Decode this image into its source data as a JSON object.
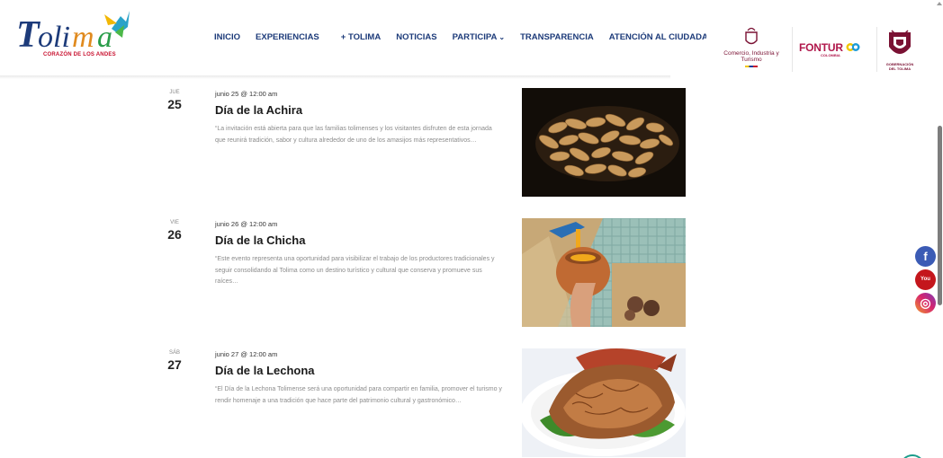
{
  "header": {
    "logo_text": "Tolima",
    "logo_tagline": "CORAZÓN DE LOS ANDES",
    "nav": [
      {
        "label": "INICIO"
      },
      {
        "label": "EXPERIENCIAS"
      },
      {
        "label": "+ TOLIMA"
      },
      {
        "label": "NOTICIAS"
      },
      {
        "label": "PARTICIPA"
      },
      {
        "label": "TRANSPARENCIA"
      },
      {
        "label": "ATENCIÓN AL CIUDADANO"
      }
    ],
    "sponsors": {
      "ministry": "Comercio, Industria y Turismo",
      "fontur": "FONTUR",
      "fontur_sub": "COLOMBIA",
      "gobernacion": "GOBERNACIÓN DEL TOLIMA"
    }
  },
  "events": [
    {
      "dow": "JUE",
      "day": "25",
      "time": "junio 25 @ 12:00 am",
      "title": "Día de la Achira",
      "description": "“La invitación está abierta para que las familias tolimenses y los visitantes disfruten de esta jornada que reunirá tradición, sabor y cultura alrededor de uno de los amasijos más representativos…",
      "image": "achira-bread-photo"
    },
    {
      "dow": "VIE",
      "day": "26",
      "time": "junio 26 @ 12:00 am",
      "title": "Día de la Chicha",
      "description": "“Este evento representa una oportunidad para visibilizar el trabajo de los productores tradicionales y seguir consolidando al Tolima como un destino turístico y cultural que conserva y promueve sus raíces…",
      "image": "chicha-pouring-photo"
    },
    {
      "dow": "SÁB",
      "day": "27",
      "time": "junio 27 @ 12:00 am",
      "title": "Día de la Lechona",
      "description": "“El Día de la Lechona Tolimense será una oportunidad para compartir en familia, promover el turismo y rendir homenaje a una tradición que hace parte del patrimonio cultural y gastronómico…",
      "image": "lechona-dish-photo"
    }
  ],
  "social": [
    {
      "name": "facebook-icon",
      "glyph": "f"
    },
    {
      "name": "youtube-icon",
      "glyph": "You"
    },
    {
      "name": "instagram-icon",
      "glyph": "◎"
    }
  ],
  "colors": {
    "nav": "#1d3b7a",
    "brand_red": "#c8102e",
    "fontur": "#b0174b"
  }
}
